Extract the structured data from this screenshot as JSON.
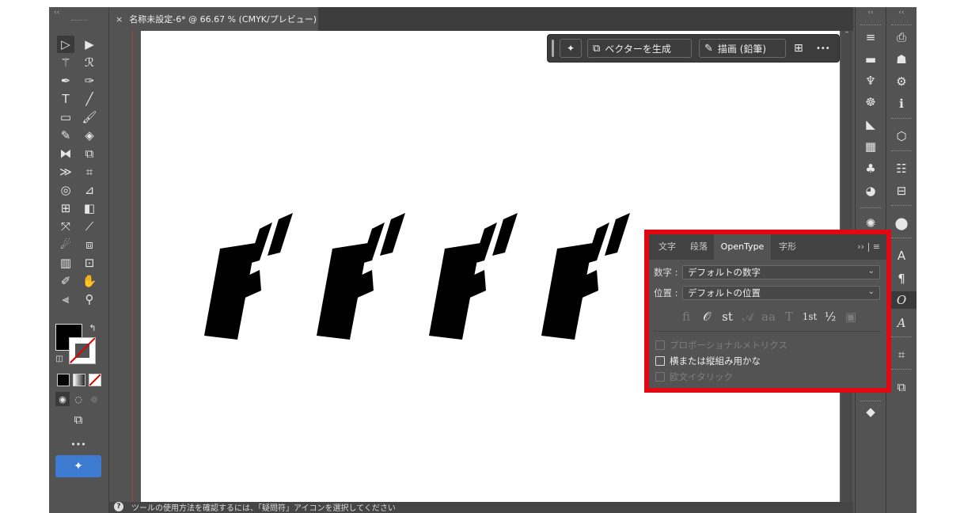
{
  "document_tab": {
    "close": "×",
    "title": "名称未設定-6* @ 66.67 % (CMYK/プレビュー)"
  },
  "status_bar": {
    "help_icon": "?",
    "text": "ツールの使用方法を確認するには、「疑問符」アイコンを選択してください"
  },
  "artwork": {
    "glyph": "ド",
    "count": 4
  },
  "task_bar": {
    "generate_vector_label": "ベクターを生成",
    "draw_pencil_label": "描画 (鉛筆)",
    "more_label": "•••"
  },
  "toolbar": {
    "more_label": "•••"
  },
  "opentype_panel": {
    "tabs": [
      "文字",
      "段落",
      "OpenType",
      "字形"
    ],
    "active_tab": "OpenType",
    "menu": "›› | ≡",
    "number_label": "数字 :",
    "number_value": "デフォルトの数字",
    "position_label": "位置 :",
    "position_value": "デフォルトの位置",
    "glyph_buttons": [
      "fi",
      "𝒪",
      "st",
      "𝒜",
      "aa",
      "T",
      "1st",
      "½",
      "▣"
    ],
    "options": [
      {
        "label": "プロポーショナルメトリクス",
        "checked": false,
        "enabled": false
      },
      {
        "label": "横または縦組み用かな",
        "checked": false,
        "enabled": true
      },
      {
        "label": "欧文イタリック",
        "checked": false,
        "enabled": false
      }
    ]
  },
  "colors": {
    "highlight": "#e20813",
    "accent": "#3d7bd0",
    "panel_bg": "#535353"
  }
}
